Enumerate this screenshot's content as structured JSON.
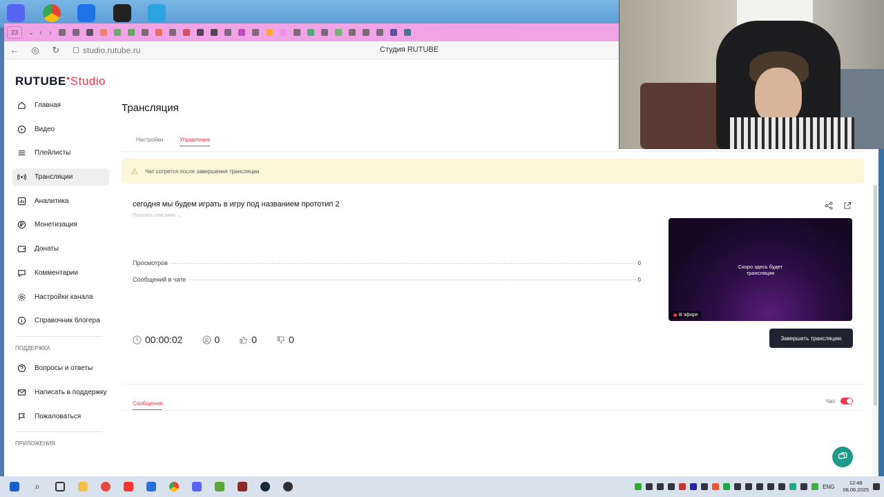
{
  "browser": {
    "tab_count": "23",
    "url": "studio.rutube.ru",
    "page_title": "Студия RUTUBE"
  },
  "app": {
    "logo_main": "RUTUBE",
    "logo_suffix": "Studio"
  },
  "sidebar": {
    "items": [
      {
        "label": "Главная",
        "icon": "home-icon"
      },
      {
        "label": "Видео",
        "icon": "video-icon"
      },
      {
        "label": "Плейлисты",
        "icon": "list-icon"
      },
      {
        "label": "Трансляции",
        "icon": "broadcast-icon"
      },
      {
        "label": "Аналитика",
        "icon": "chart-icon"
      },
      {
        "label": "Монетизация",
        "icon": "money-icon"
      },
      {
        "label": "Донаты",
        "icon": "wallet-icon"
      },
      {
        "label": "Комментарии",
        "icon": "comment-icon"
      },
      {
        "label": "Настройки канала",
        "icon": "gear-icon"
      },
      {
        "label": "Справочник блогера",
        "icon": "info-icon"
      }
    ],
    "support_section": "ПОДДЕРЖКА",
    "support_items": [
      {
        "label": "Вопросы и ответы",
        "icon": "question-icon"
      },
      {
        "label": "Написать в поддержку",
        "icon": "mail-icon"
      },
      {
        "label": "Пожаловаться",
        "icon": "flag-icon"
      }
    ],
    "apps_section": "ПРИЛОЖЕНИЯ"
  },
  "main": {
    "title": "Трансляция",
    "tabs": [
      "Настройки",
      "Управление"
    ],
    "active_tab": "Управление",
    "alert": "Чат сотрется после завершения трансляции",
    "stream": {
      "title": "сегодня мы будем играть в игру под названием прототип 2",
      "show_description": "Показать описание",
      "views_label": "Просмотров",
      "views_value": "0",
      "chat_msgs_label": "Сообщений в чате",
      "chat_msgs_value": "0",
      "duration": "00:00:02",
      "viewers": "0",
      "likes": "0",
      "dislikes": "0",
      "preview_text_line1": "Скоро здесь будет",
      "preview_text_line2": "трансляция",
      "live_badge": "В эфире",
      "end_button": "Завершить трансляцию"
    },
    "messages_tab": "Сообщения",
    "chat_toggle_label": "Чат",
    "chat_enabled": true
  },
  "taskbar": {
    "lang": "ENG",
    "time": "12:48",
    "date": "08.06.2025"
  },
  "colors": {
    "accent": "#f0384c",
    "tab_bar": "#f0a4e6",
    "end_button": "#1f2330",
    "help_fab": "#1f9a8a"
  }
}
